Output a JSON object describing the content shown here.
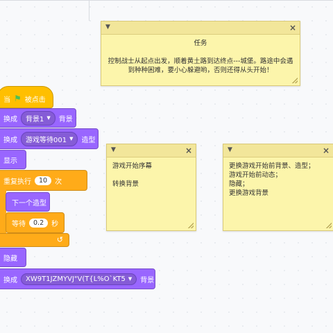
{
  "notes": [
    {
      "id": "task",
      "body": "任务\n\n控制战士从起点出发，顺着黄土路到达终点---城堡。路途中会遇到种种困难，要小心躲避哟，否则还得从头开始！"
    },
    {
      "id": "start",
      "body": "游戏开始序幕\n\n转换背景"
    },
    {
      "id": "change",
      "body": "更换游戏开始前背景、造型；\n游戏开始前动态；\n隐藏；\n更换游戏背景"
    }
  ],
  "script": {
    "hat": {
      "when": "当",
      "flag_icon": "green-flag-icon",
      "clicked": "被点击"
    },
    "switch_backdrop_1": {
      "label": "换成",
      "value": "背景1",
      "suffix": "背景"
    },
    "switch_costume": {
      "label": "换成",
      "value": "游戏等待001",
      "suffix": "造型"
    },
    "show": {
      "label": "显示"
    },
    "repeat": {
      "label": "重复执行",
      "count": "10",
      "suffix": "次"
    },
    "next_costume": {
      "label": "下一个造型"
    },
    "wait": {
      "label": "等待",
      "value": "0.2",
      "suffix": "秒"
    },
    "hide": {
      "label": "隐藏"
    },
    "switch_backdrop_2": {
      "label": "换成",
      "value": "XW9T1JZMYVJ\"V(T{L%O`KT5",
      "suffix": "背景"
    }
  },
  "colors": {
    "looks": "#9966ff",
    "control": "#ffab19",
    "event": "#ffbf00",
    "note": "#fcf5ab"
  }
}
